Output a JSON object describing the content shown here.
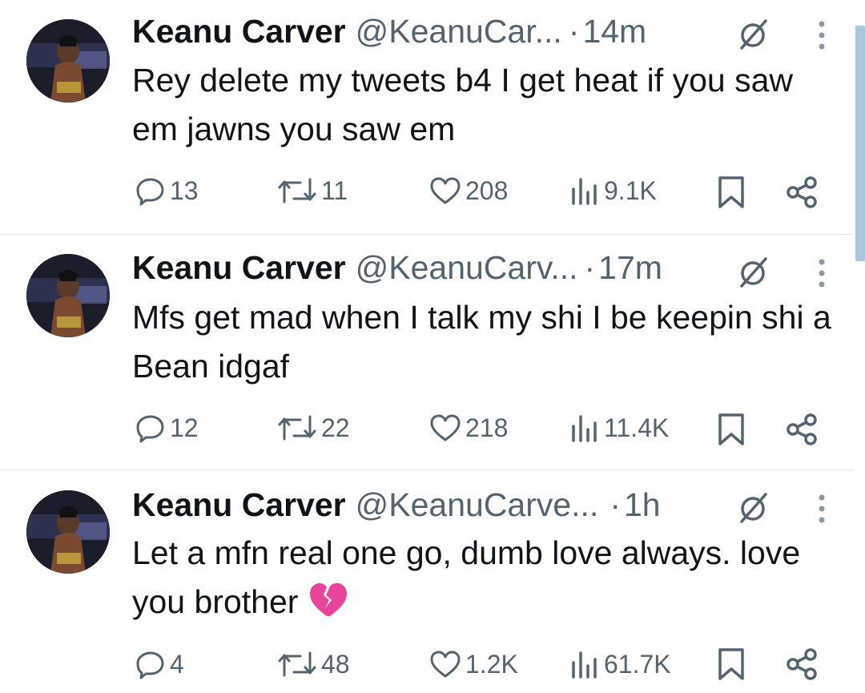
{
  "tweets": [
    {
      "name": "Keanu Carver",
      "handle": "@KeanuCar...",
      "separator": "·",
      "time": "14m",
      "text": "Rey delete my tweets b4 I get heat if you saw em jawns you saw em",
      "emoji": "",
      "replies": "13",
      "reposts": "11",
      "likes": "208",
      "views": "9.1K"
    },
    {
      "name": "Keanu Carver",
      "handle": "@KeanuCarv...",
      "separator": "·",
      "time": "17m",
      "text": "Mfs get mad when I talk my shi I be keepin shi a Bean idgaf",
      "emoji": "",
      "replies": "12",
      "reposts": "22",
      "likes": "218",
      "views": "11.4K"
    },
    {
      "name": "Keanu Carver",
      "handle": "@KeanuCarve...",
      "separator": "·",
      "time": "1h",
      "text": "Let a mfn real one go, dumb love always. love you brother",
      "emoji": "💔",
      "replies": "4",
      "reposts": "48",
      "likes": "1.2K",
      "views": "61.7K"
    }
  ],
  "icons": {
    "reply": "reply-icon",
    "repost": "repost-icon",
    "like": "heart-icon",
    "views": "views-icon",
    "bookmark": "bookmark-icon",
    "share": "share-icon",
    "grok": "grok-icon",
    "more": "more-icon"
  },
  "colors": {
    "text": "#0f1419",
    "secondary": "#536471",
    "divider": "#e1e5e8",
    "scrollbar": "#a9c6db",
    "broken_heart": "#e8459a"
  }
}
